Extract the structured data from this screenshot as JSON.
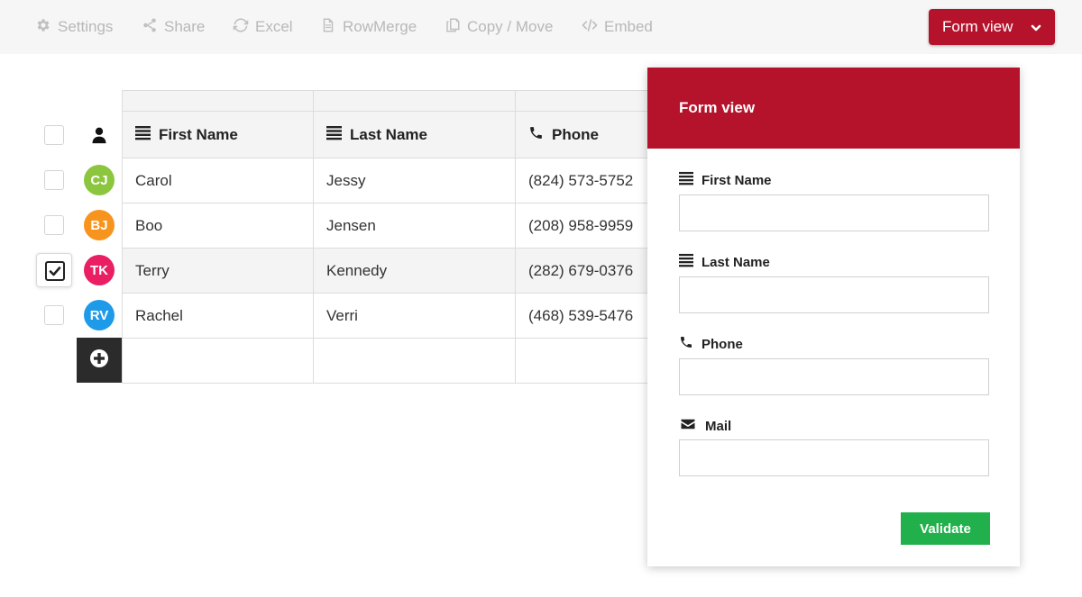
{
  "toolbar": {
    "settings": "Settings",
    "share": "Share",
    "excel": "Excel",
    "rowmerge": "RowMerge",
    "copy_move": "Copy / Move",
    "embed": "Embed",
    "view_selector": "Form view"
  },
  "table": {
    "columns": [
      {
        "label": "First Name",
        "icon": "text-lines-icon"
      },
      {
        "label": "Last Name",
        "icon": "text-lines-icon"
      },
      {
        "label": "Phone",
        "icon": "phone-icon"
      }
    ],
    "rows": [
      {
        "initials": "CJ",
        "color": "#8cc63f",
        "first": "Carol",
        "last": "Jessy",
        "phone": "(824) 573-5752",
        "checked": false
      },
      {
        "initials": "BJ",
        "color": "#f7941d",
        "first": "Boo",
        "last": "Jensen",
        "phone": "(208) 958-9959",
        "checked": false
      },
      {
        "initials": "TK",
        "color": "#e91e63",
        "first": "Terry",
        "last": "Kennedy",
        "phone": "(282) 679-0376",
        "checked": true
      },
      {
        "initials": "RV",
        "color": "#1e9be8",
        "first": "Rachel",
        "last": "Verri",
        "phone": "(468) 539-5476",
        "checked": false
      }
    ]
  },
  "form": {
    "title": "Form view",
    "fields": [
      {
        "label": "First Name",
        "icon": "text-lines-icon",
        "value": ""
      },
      {
        "label": "Last Name",
        "icon": "text-lines-icon",
        "value": ""
      },
      {
        "label": "Phone",
        "icon": "phone-icon",
        "value": ""
      },
      {
        "label": "Mail",
        "icon": "envelope-icon",
        "value": ""
      }
    ],
    "submit": "Validate"
  },
  "colors": {
    "accent": "#b5132b",
    "validate": "#21b04b"
  }
}
